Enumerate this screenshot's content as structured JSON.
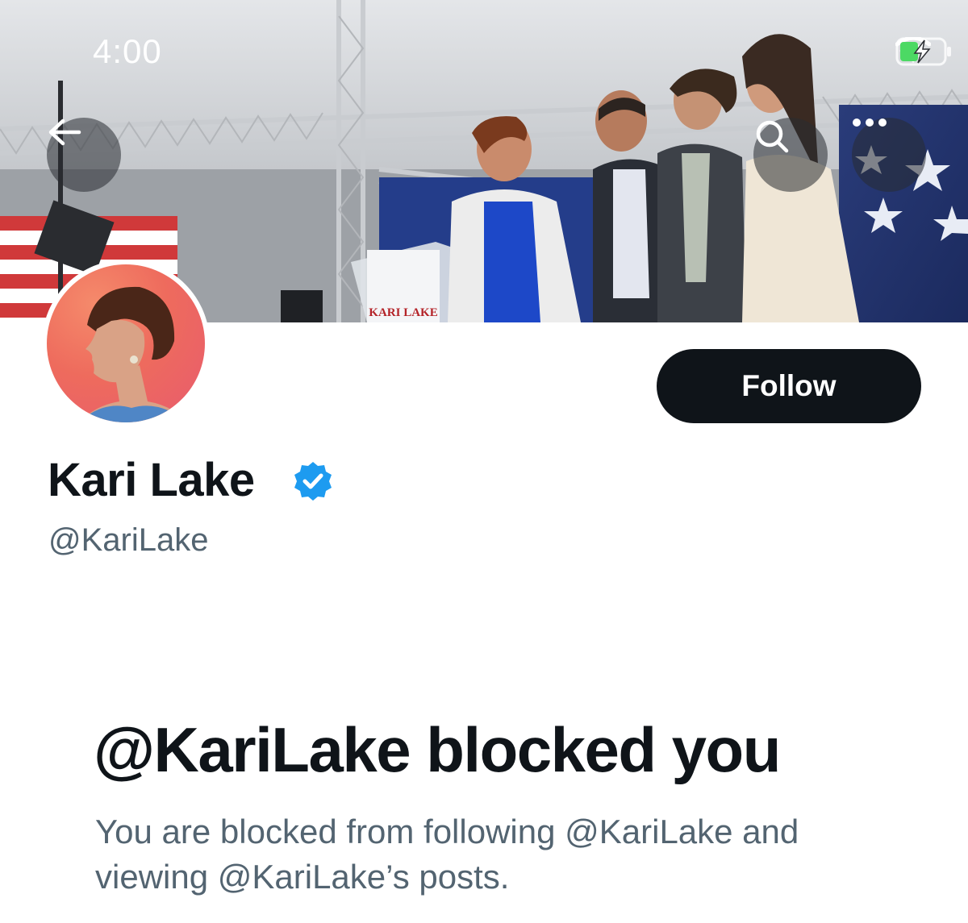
{
  "status_bar": {
    "time": "4:00",
    "wifi_icon": "wifi-icon",
    "battery_icon": "battery-charging-icon"
  },
  "header": {
    "back_icon": "arrow-left-icon",
    "search_icon": "search-icon",
    "more_icon": "more-horizontal-icon"
  },
  "banner": {
    "sign_text": "KARI LAKE"
  },
  "profile": {
    "display_name": "Kari Lake",
    "handle": "@KariLake",
    "verified_icon": "verified-badge-icon",
    "follow_label": "Follow"
  },
  "blocked": {
    "title": "@KariLake blocked you",
    "description": "You are blocked from following @KariLake and viewing @KariLake’s posts."
  },
  "colors": {
    "primary_text": "#0f1419",
    "secondary_text": "#536471",
    "follow_bg": "#0f1419",
    "verified_blue": "#1d9bf0",
    "battery_green": "#4cd964"
  }
}
